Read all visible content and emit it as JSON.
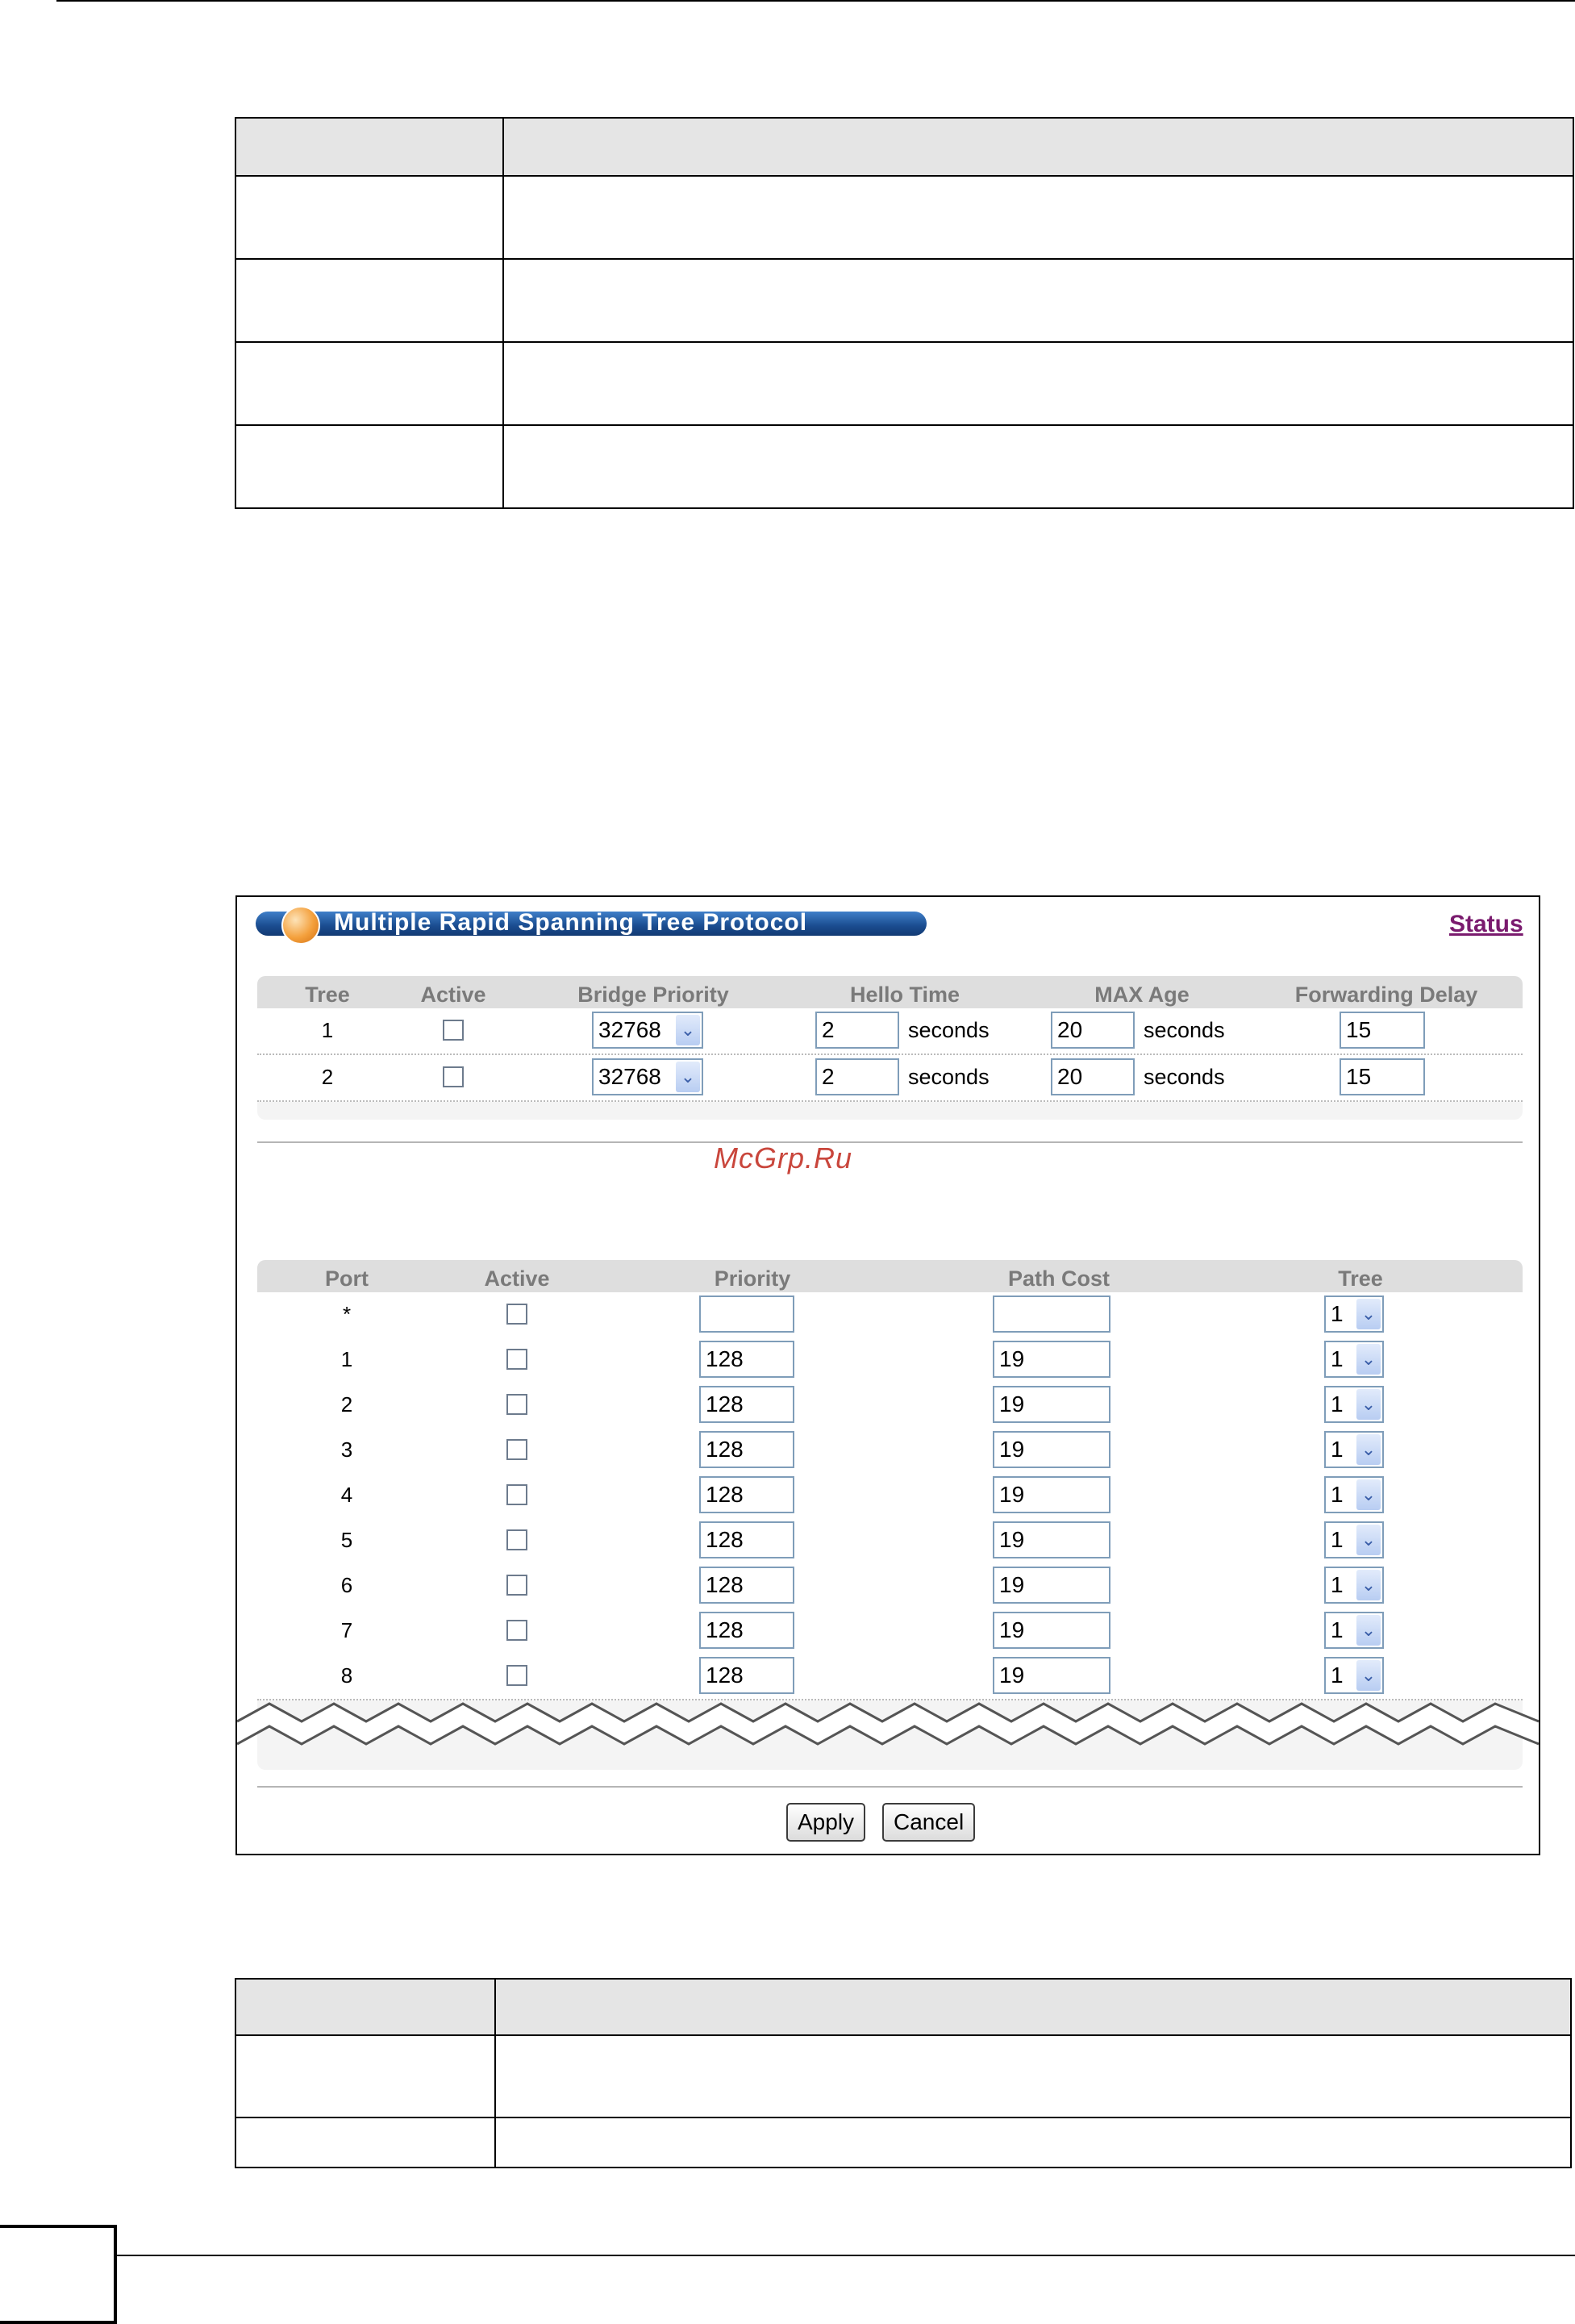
{
  "figure": {
    "title": "Multiple Rapid Spanning Tree Protocol",
    "status_link": "Status",
    "tree_table": {
      "headers": [
        "Tree",
        "Active",
        "Bridge Priority",
        "Hello Time",
        "MAX Age",
        "Forwarding Delay"
      ],
      "rows": [
        {
          "tree": "1",
          "bridge_priority": "32768",
          "hello_time": "2",
          "max_age": "20",
          "forwarding_delay": "15"
        },
        {
          "tree": "2",
          "bridge_priority": "32768",
          "hello_time": "2",
          "max_age": "20",
          "forwarding_delay": "15"
        }
      ],
      "unit": "seconds"
    },
    "port_table": {
      "headers": [
        "Port",
        "Active",
        "Priority",
        "Path Cost",
        "Tree"
      ],
      "rows": [
        {
          "port": "*",
          "priority": "",
          "path_cost": "",
          "tree": "1"
        },
        {
          "port": "1",
          "priority": "128",
          "path_cost": "19",
          "tree": "1"
        },
        {
          "port": "2",
          "priority": "128",
          "path_cost": "19",
          "tree": "1"
        },
        {
          "port": "3",
          "priority": "128",
          "path_cost": "19",
          "tree": "1"
        },
        {
          "port": "4",
          "priority": "128",
          "path_cost": "19",
          "tree": "1"
        },
        {
          "port": "5",
          "priority": "128",
          "path_cost": "19",
          "tree": "1"
        },
        {
          "port": "6",
          "priority": "128",
          "path_cost": "19",
          "tree": "1"
        },
        {
          "port": "7",
          "priority": "128",
          "path_cost": "19",
          "tree": "1"
        },
        {
          "port": "8",
          "priority": "128",
          "path_cost": "19",
          "tree": "1"
        }
      ]
    },
    "buttons": {
      "apply": "Apply",
      "cancel": "Cancel"
    }
  },
  "watermark": "McGrp.Ru",
  "colors": {
    "title_bar": "#1a4c8f",
    "status_link": "#7a1b6e",
    "header_text": "#7a7a7a",
    "watermark": "#c9463c"
  }
}
